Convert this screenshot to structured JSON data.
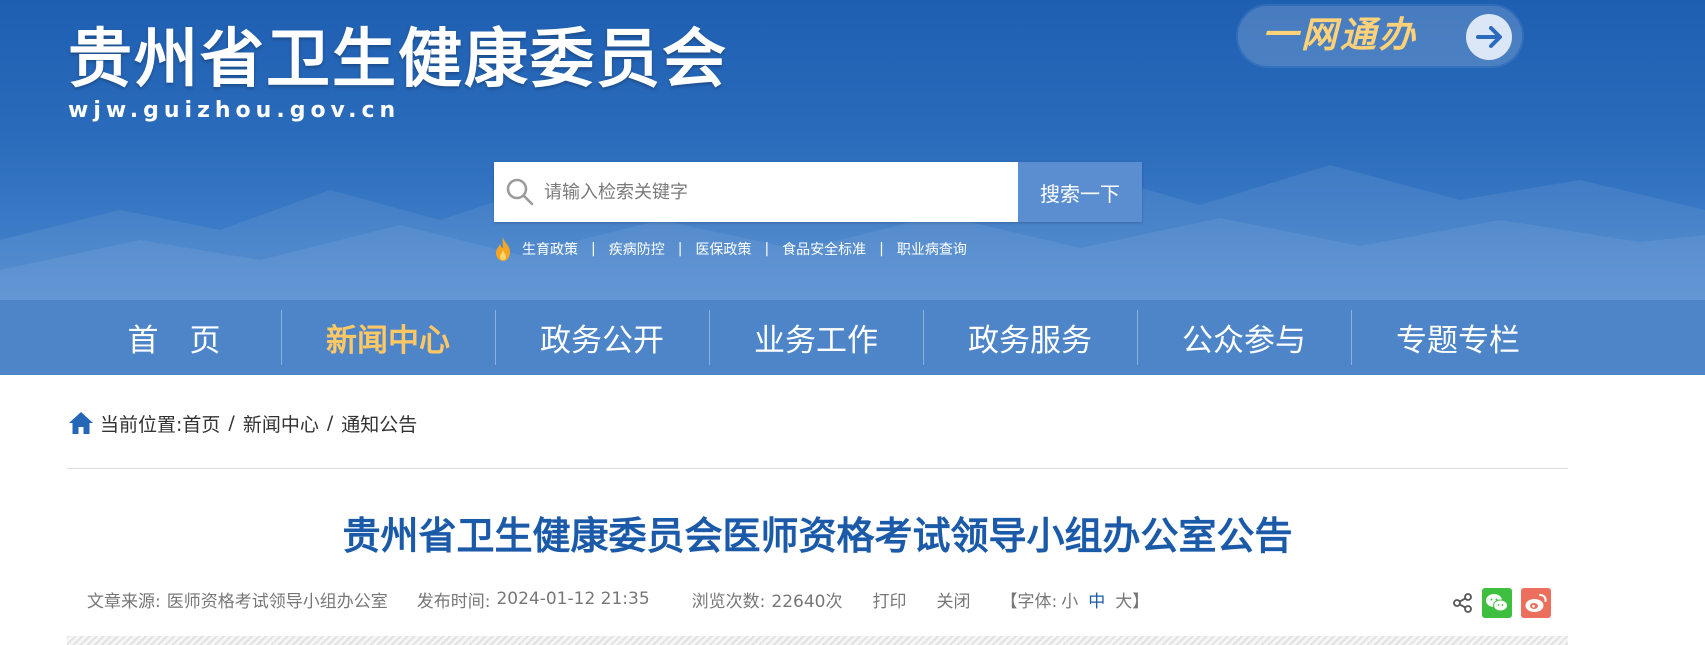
{
  "header": {
    "site_title": "贵州省卫生健康委员会",
    "site_domain": "wjw.guizhou.gov.cn",
    "ywtb_label": "一网通办"
  },
  "search": {
    "placeholder": "请输入检索关键字",
    "button_label": "搜索一下"
  },
  "hot_links": [
    "生育政策",
    "疾病防控",
    "医保政策",
    "食品安全标准",
    "职业病查询"
  ],
  "hot_separator": "|",
  "nav": {
    "items": [
      "首　页",
      "新闻中心",
      "政务公开",
      "业务工作",
      "政务服务",
      "公众参与",
      "专题专栏"
    ],
    "active_index": 1
  },
  "breadcrumb": {
    "prefix": "当前位置:",
    "items": [
      "首页",
      "新闻中心",
      "通知公告"
    ],
    "separator": "/"
  },
  "article": {
    "title": "贵州省卫生健康委员会医师资格考试领导小组办公室公告",
    "source_label": "文章来源:",
    "source_value": "医师资格考试领导小组办公室",
    "time_label": "发布时间:",
    "time_value": "2024-01-12 21:35",
    "views_label": "浏览次数:",
    "views_value": "22640次",
    "print_label": "打印",
    "close_label": "关闭",
    "font_prefix": "【字体:",
    "font_small": "小",
    "font_medium": "中",
    "font_large": "大",
    "font_suffix": "】"
  },
  "colors": {
    "header_blue": "#1f5fb2",
    "nav_blue": "#4d85c8",
    "nav_active": "#ffc864",
    "title_blue": "#1b5aa8",
    "wechat_green": "#3fbf3f",
    "weibo_red": "#ec6f5e"
  },
  "icons": [
    "search-icon",
    "flame-icon",
    "arrow-right-icon",
    "home-icon",
    "share-icon",
    "wechat-icon",
    "weibo-icon"
  ]
}
